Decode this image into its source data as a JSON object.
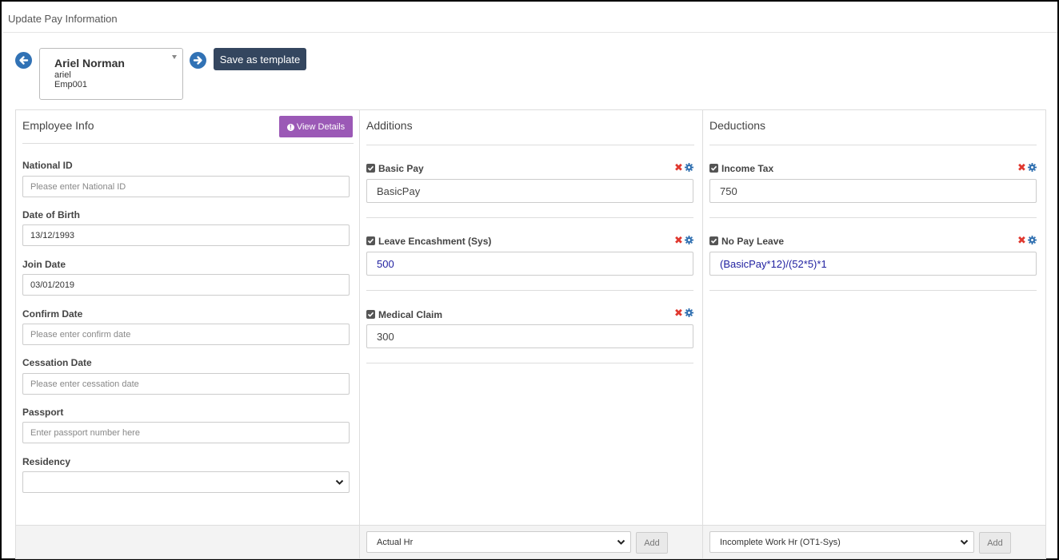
{
  "page": {
    "title": "Update Pay Information"
  },
  "employee_selector": {
    "name": "Ariel Norman",
    "username": "ariel",
    "code": "Emp001"
  },
  "toolbar": {
    "save_template_label": "Save as template"
  },
  "employee_info": {
    "title": "Employee Info",
    "view_details_label": "View Details",
    "fields": {
      "national_id": {
        "label": "National ID",
        "value": "",
        "placeholder": "Please enter National ID"
      },
      "date_of_birth": {
        "label": "Date of Birth",
        "value": "13/12/1993",
        "placeholder": ""
      },
      "join_date": {
        "label": "Join Date",
        "value": "03/01/2019",
        "placeholder": ""
      },
      "confirm_date": {
        "label": "Confirm Date",
        "value": "",
        "placeholder": "Please enter confirm date"
      },
      "cessation_date": {
        "label": "Cessation Date",
        "value": "",
        "placeholder": "Please enter cessation date"
      },
      "passport": {
        "label": "Passport",
        "value": "",
        "placeholder": "Enter passport number here"
      },
      "residency": {
        "label": "Residency",
        "value": ""
      }
    }
  },
  "additions": {
    "title": "Additions",
    "items": [
      {
        "label": "Basic Pay",
        "value": "BasicPay",
        "checked": true
      },
      {
        "label": "Leave Encashment (Sys)",
        "value": "500",
        "checked": true
      },
      {
        "label": "Medical Claim",
        "value": "300",
        "checked": true
      }
    ],
    "footer": {
      "selected": "Actual Hr",
      "add_label": "Add"
    }
  },
  "deductions": {
    "title": "Deductions",
    "items": [
      {
        "label": "Income Tax",
        "value": "750",
        "checked": true
      },
      {
        "label": "No Pay Leave",
        "value": "(BasicPay*12)/(52*5)*1",
        "checked": true
      }
    ],
    "footer": {
      "selected": "Incomplete Work Hr (OT1-Sys)",
      "add_label": "Add"
    }
  },
  "colors": {
    "nav_arrow": "#3172b5",
    "template_button": "#34465f",
    "view_details_button": "#9b59b6",
    "remove_icon": "#e0382f",
    "settings_icon": "#2f6fb0",
    "formula_text": "#1f1fa0"
  },
  "icons": {
    "prev": "arrow-circle-left-icon",
    "next": "arrow-circle-right-icon",
    "info": "info-circle-icon",
    "check": "checkbox-checked-icon",
    "remove": "close-icon",
    "settings": "gear-icon",
    "dropdown": "chevron-down-icon"
  }
}
